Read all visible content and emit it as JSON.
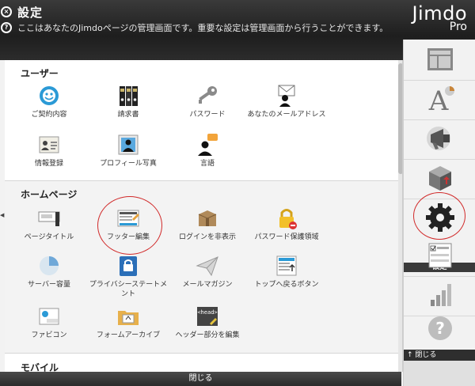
{
  "header": {
    "title": "設定",
    "description": "ここはあなたのJimdoページの管理画面です。重要な設定は管理画面から行うことができます。",
    "brand": "Jimdo",
    "brand_sub": "Pro"
  },
  "sections": {
    "users": {
      "title": "ユーザー",
      "items": [
        {
          "label": "ご契約内容",
          "icon": "contract-icon"
        },
        {
          "label": "請求書",
          "icon": "invoice-icon"
        },
        {
          "label": "パスワード",
          "icon": "key-icon"
        },
        {
          "label": "あなたのメールアドレス",
          "icon": "email-icon"
        },
        {
          "label": "情報登録",
          "icon": "id-card-icon"
        },
        {
          "label": "プロフィール写真",
          "icon": "profile-photo-icon"
        },
        {
          "label": "言語",
          "icon": "language-icon"
        }
      ]
    },
    "homepage": {
      "title": "ホームページ",
      "items": [
        {
          "label": "ページタイトル",
          "icon": "page-title-icon"
        },
        {
          "label": "フッター編集",
          "icon": "footer-edit-icon"
        },
        {
          "label": "ログインを非表示",
          "icon": "login-hide-icon"
        },
        {
          "label": "パスワード保護領域",
          "icon": "lock-icon"
        },
        {
          "label": "サーバー容量",
          "icon": "pie-chart-icon"
        },
        {
          "label": "プライバシーステートメント",
          "icon": "privacy-icon"
        },
        {
          "label": "メールマガジン",
          "icon": "paper-plane-icon"
        },
        {
          "label": "トップへ戻るボタン",
          "icon": "back-to-top-icon"
        },
        {
          "label": "ファビコン",
          "icon": "favicon-icon"
        },
        {
          "label": "フォームアーカイブ",
          "icon": "folder-icon"
        },
        {
          "label": "ヘッダー部分を編集",
          "icon": "head-tag-icon"
        }
      ]
    },
    "mobile": {
      "title": "モバイル"
    }
  },
  "bottom_bar": {
    "label": "閉じる"
  },
  "toolbar": {
    "settings_label": "設定",
    "close_label": "↑ 閉じる",
    "buttons": [
      "layout-icon",
      "font-icon",
      "megaphone-icon",
      "box-icon",
      "gear-icon",
      "checklist-icon",
      "stats-icon",
      "help-icon"
    ]
  },
  "colors": {
    "header_bg": "#222222",
    "highlight_circle": "#d12a2a",
    "accent_blue": "#2b9ad6"
  }
}
